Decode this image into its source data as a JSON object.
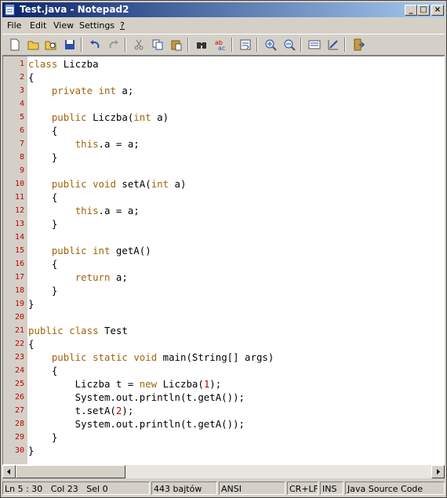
{
  "window": {
    "title": "Test.java - Notepad2"
  },
  "titlebar_buttons": [
    "minimize-button",
    "maximize-button",
    "close-button"
  ],
  "menu": [
    {
      "key": "file",
      "label": "File"
    },
    {
      "key": "edit",
      "label": "Edit"
    },
    {
      "key": "view",
      "label": "View"
    },
    {
      "key": "settings",
      "label": "Settings"
    },
    {
      "key": "help",
      "label": "?"
    }
  ],
  "toolbar": [
    "new-file-icon",
    "open-folder-icon",
    "browse-icon",
    "save-icon",
    "undo-icon",
    "redo-icon",
    "cut-icon",
    "copy-icon",
    "paste-icon",
    "find-icon",
    "replace-icon",
    "word-wrap-icon",
    "zoom-in-icon",
    "zoom-out-icon",
    "scheme-icon",
    "customize-scheme-icon",
    "exit-icon"
  ],
  "editor": {
    "lines": [
      [
        [
          "kw",
          "class"
        ],
        [
          "t",
          " Liczba"
        ]
      ],
      [
        [
          "t",
          "{"
        ]
      ],
      [
        [
          "t",
          "    "
        ],
        [
          "kw",
          "private"
        ],
        [
          "t",
          " "
        ],
        [
          "kw",
          "int"
        ],
        [
          "t",
          " a;"
        ]
      ],
      [
        [
          "t",
          ""
        ]
      ],
      [
        [
          "t",
          "    "
        ],
        [
          "kw",
          "public"
        ],
        [
          "t",
          " Liczba("
        ],
        [
          "kw",
          "int"
        ],
        [
          "t",
          " a)"
        ]
      ],
      [
        [
          "t",
          "    {"
        ]
      ],
      [
        [
          "t",
          "        "
        ],
        [
          "kw",
          "this"
        ],
        [
          "t",
          ".a = a;"
        ]
      ],
      [
        [
          "t",
          "    }"
        ]
      ],
      [
        [
          "t",
          ""
        ]
      ],
      [
        [
          "t",
          "    "
        ],
        [
          "kw",
          "public"
        ],
        [
          "t",
          " "
        ],
        [
          "kw",
          "void"
        ],
        [
          "t",
          " setA("
        ],
        [
          "kw",
          "int"
        ],
        [
          "t",
          " a)"
        ]
      ],
      [
        [
          "t",
          "    {"
        ]
      ],
      [
        [
          "t",
          "        "
        ],
        [
          "kw",
          "this"
        ],
        [
          "t",
          ".a = a;"
        ]
      ],
      [
        [
          "t",
          "    }"
        ]
      ],
      [
        [
          "t",
          ""
        ]
      ],
      [
        [
          "t",
          "    "
        ],
        [
          "kw",
          "public"
        ],
        [
          "t",
          " "
        ],
        [
          "kw",
          "int"
        ],
        [
          "t",
          " getA()"
        ]
      ],
      [
        [
          "t",
          "    {"
        ]
      ],
      [
        [
          "t",
          "        "
        ],
        [
          "kw",
          "return"
        ],
        [
          "t",
          " a;"
        ]
      ],
      [
        [
          "t",
          "    }"
        ]
      ],
      [
        [
          "t",
          "}"
        ]
      ],
      [
        [
          "t",
          ""
        ]
      ],
      [
        [
          "kw",
          "public"
        ],
        [
          "t",
          " "
        ],
        [
          "kw",
          "class"
        ],
        [
          "t",
          " Test"
        ]
      ],
      [
        [
          "t",
          "{"
        ]
      ],
      [
        [
          "t",
          "    "
        ],
        [
          "kw",
          "public"
        ],
        [
          "t",
          " "
        ],
        [
          "kw",
          "static"
        ],
        [
          "t",
          " "
        ],
        [
          "kw",
          "void"
        ],
        [
          "t",
          " main(String[] args)"
        ]
      ],
      [
        [
          "t",
          "    {"
        ]
      ],
      [
        [
          "t",
          "        Liczba t = "
        ],
        [
          "kw",
          "new"
        ],
        [
          "t",
          " Liczba("
        ],
        [
          "num",
          "1"
        ],
        [
          "t",
          ");"
        ]
      ],
      [
        [
          "t",
          "        System.out.println(t.getA());"
        ]
      ],
      [
        [
          "t",
          "        t.setA("
        ],
        [
          "num",
          "2"
        ],
        [
          "t",
          ");"
        ]
      ],
      [
        [
          "t",
          "        System.out.println(t.getA());"
        ]
      ],
      [
        [
          "t",
          "    }"
        ]
      ],
      [
        [
          "t",
          "}"
        ]
      ]
    ]
  },
  "status": {
    "position": "Ln 5 : 30",
    "column": "Col 23",
    "selection": "Sel 0",
    "size": "443 bajtów",
    "encoding": "ANSI",
    "line_endings": "CR+LF",
    "insert_mode": "INS",
    "scheme": "Java Source Code"
  },
  "colors": {
    "keyword": "#a0640a",
    "number": "#c00000",
    "line_number": "#c00000",
    "title_gradient_start": "#0a246a"
  }
}
